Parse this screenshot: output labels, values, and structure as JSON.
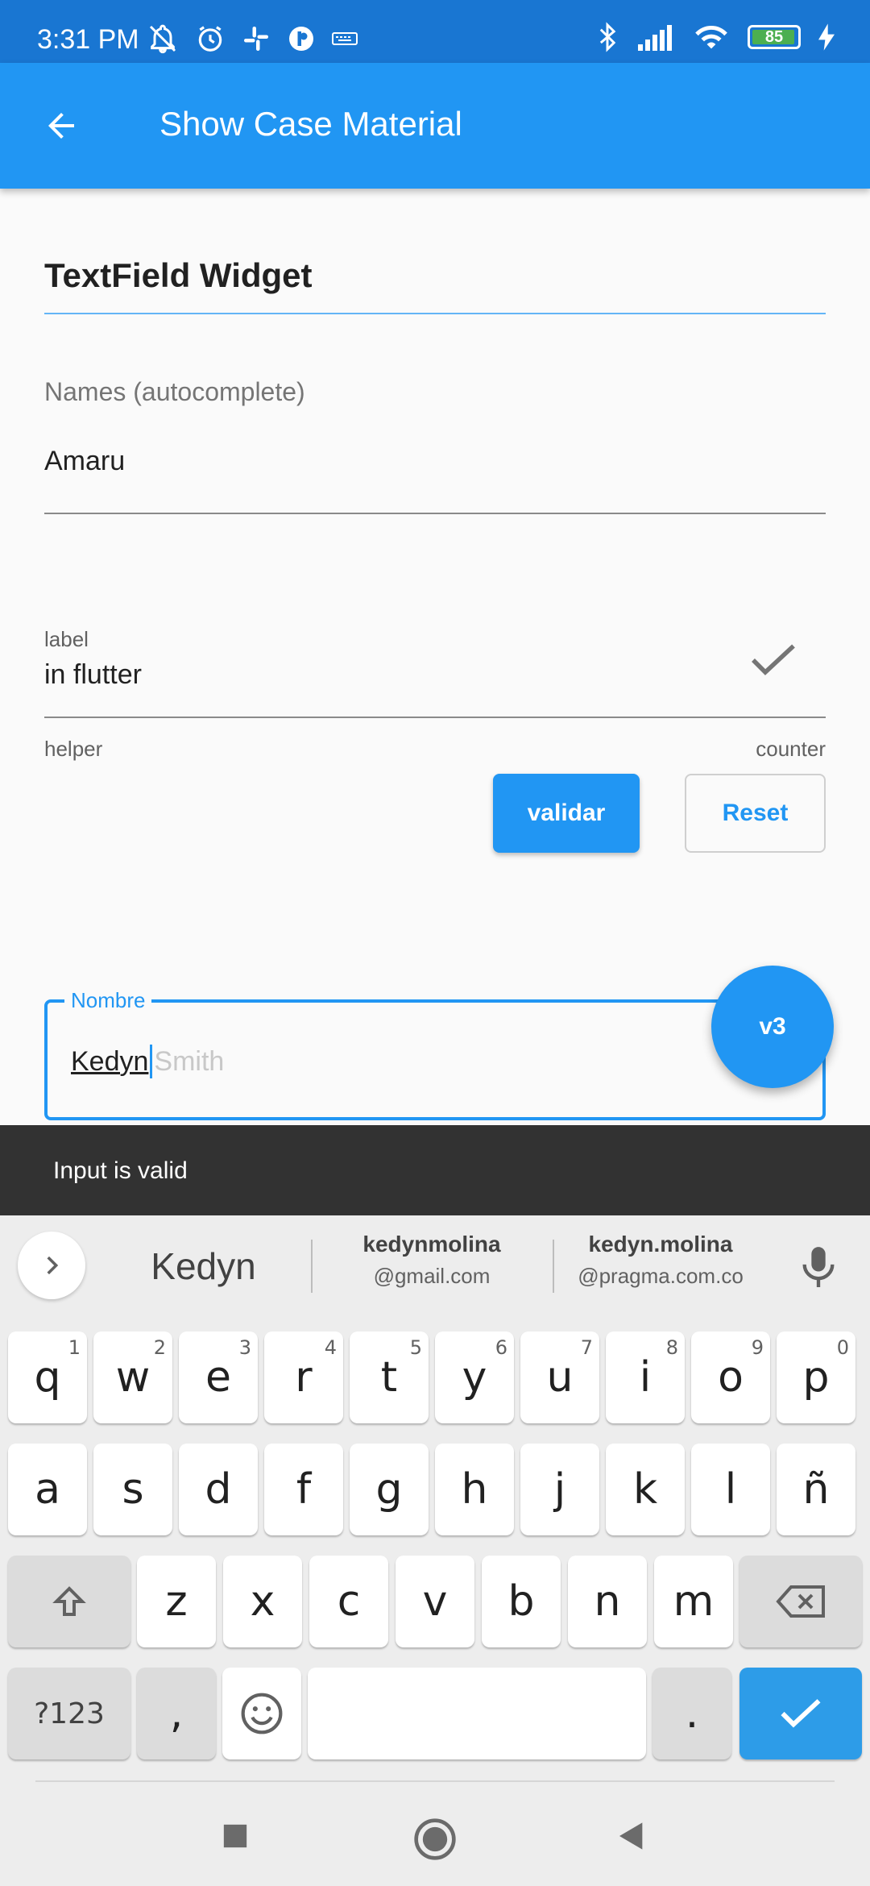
{
  "status_bar": {
    "time": "3:31 PM",
    "battery": "85"
  },
  "app_bar": {
    "title": "Show Case Material"
  },
  "section": {
    "title": "TextField Widget"
  },
  "names_field": {
    "label": "Names (autocomplete)",
    "value": "Amaru"
  },
  "label_field": {
    "label": "label",
    "value": "in flutter",
    "helper": "helper",
    "counter": "counter"
  },
  "buttons": {
    "validate": "validar",
    "reset": "Reset"
  },
  "nombre_field": {
    "label": "Nombre",
    "typed": "Kedyn",
    "suggestion": "Smith"
  },
  "fab": {
    "label": "v3"
  },
  "snackbar": {
    "message": "Input is valid"
  },
  "keyboard": {
    "suggestions": {
      "main": "Kedyn",
      "s2_line1": "kedynmolina",
      "s2_line2": "@gmail.com",
      "s3_line1": "kedyn.molina",
      "s3_line2": "@pragma.com.co"
    },
    "row1": [
      {
        "k": "q",
        "h": "1"
      },
      {
        "k": "w",
        "h": "2"
      },
      {
        "k": "e",
        "h": "3"
      },
      {
        "k": "r",
        "h": "4"
      },
      {
        "k": "t",
        "h": "5"
      },
      {
        "k": "y",
        "h": "6"
      },
      {
        "k": "u",
        "h": "7"
      },
      {
        "k": "i",
        "h": "8"
      },
      {
        "k": "o",
        "h": "9"
      },
      {
        "k": "p",
        "h": "0"
      }
    ],
    "row2": [
      "a",
      "s",
      "d",
      "f",
      "g",
      "h",
      "j",
      "k",
      "l",
      "ñ"
    ],
    "row3": [
      "z",
      "x",
      "c",
      "v",
      "b",
      "n",
      "m"
    ],
    "symbols": "?123",
    "comma": ",",
    "period": "."
  },
  "colors": {
    "primary": "#2196f3",
    "status_bar": "#1976d2",
    "snackbar": "#323232",
    "enter_key": "#2d9ce8"
  }
}
